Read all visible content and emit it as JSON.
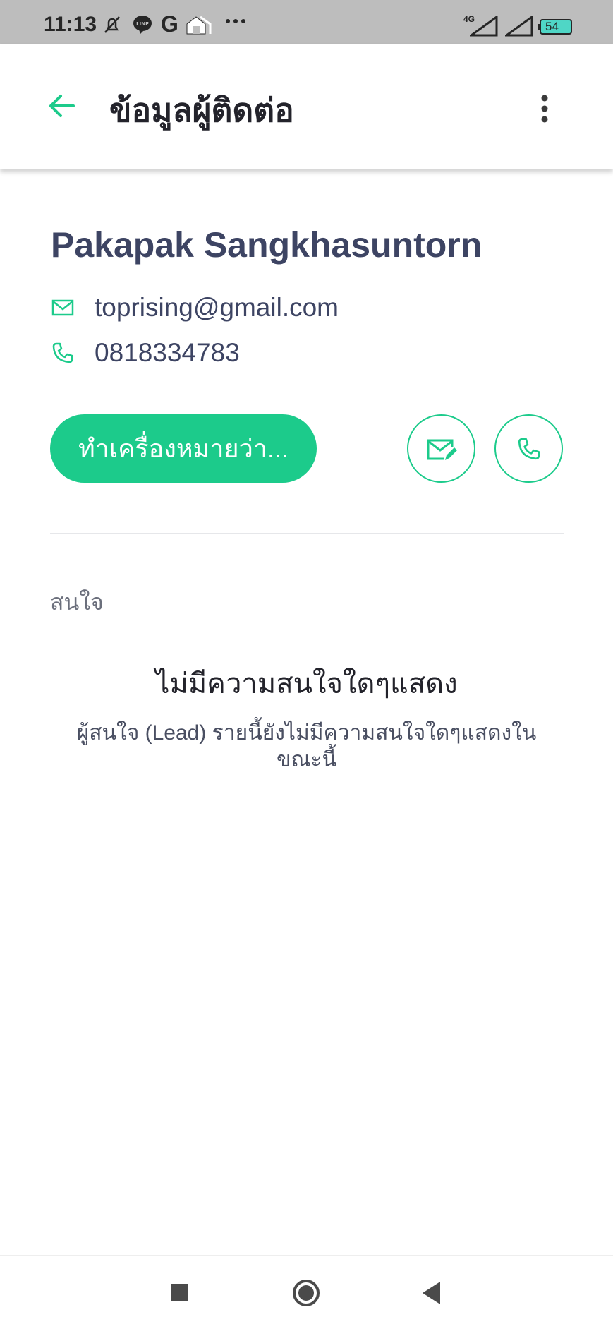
{
  "status_bar": {
    "time": "11:13",
    "network": "4G",
    "battery": "54",
    "icons": [
      "mute-bell-icon",
      "line-icon",
      "g-icon",
      "home-app-icon",
      "more-notifications-icon",
      "signal-icon",
      "signal-icon",
      "battery-icon"
    ]
  },
  "app_bar": {
    "title": "ข้อมูลผู้ติดต่อ",
    "back_icon": "arrow-left-icon",
    "menu_icon": "more-vertical-icon"
  },
  "contact": {
    "name": "Pakapak Sangkhasuntorn",
    "email": "toprising@gmail.com",
    "phone": "0818334783"
  },
  "actions": {
    "mark_as_label": "ทำเครื่องหมายว่า..."
  },
  "interests": {
    "section_label": "สนใจ",
    "empty_title": "ไม่มีความสนใจใดๆแสดง",
    "empty_description": "ผู้สนใจ (Lead) รายนี้ยังไม่มีความสนใจใดๆแสดงในขณะนี้"
  },
  "colors": {
    "accent": "#1ccb8b",
    "text_primary": "#3d4463",
    "status_bar_bg": "#bdbdbd"
  }
}
